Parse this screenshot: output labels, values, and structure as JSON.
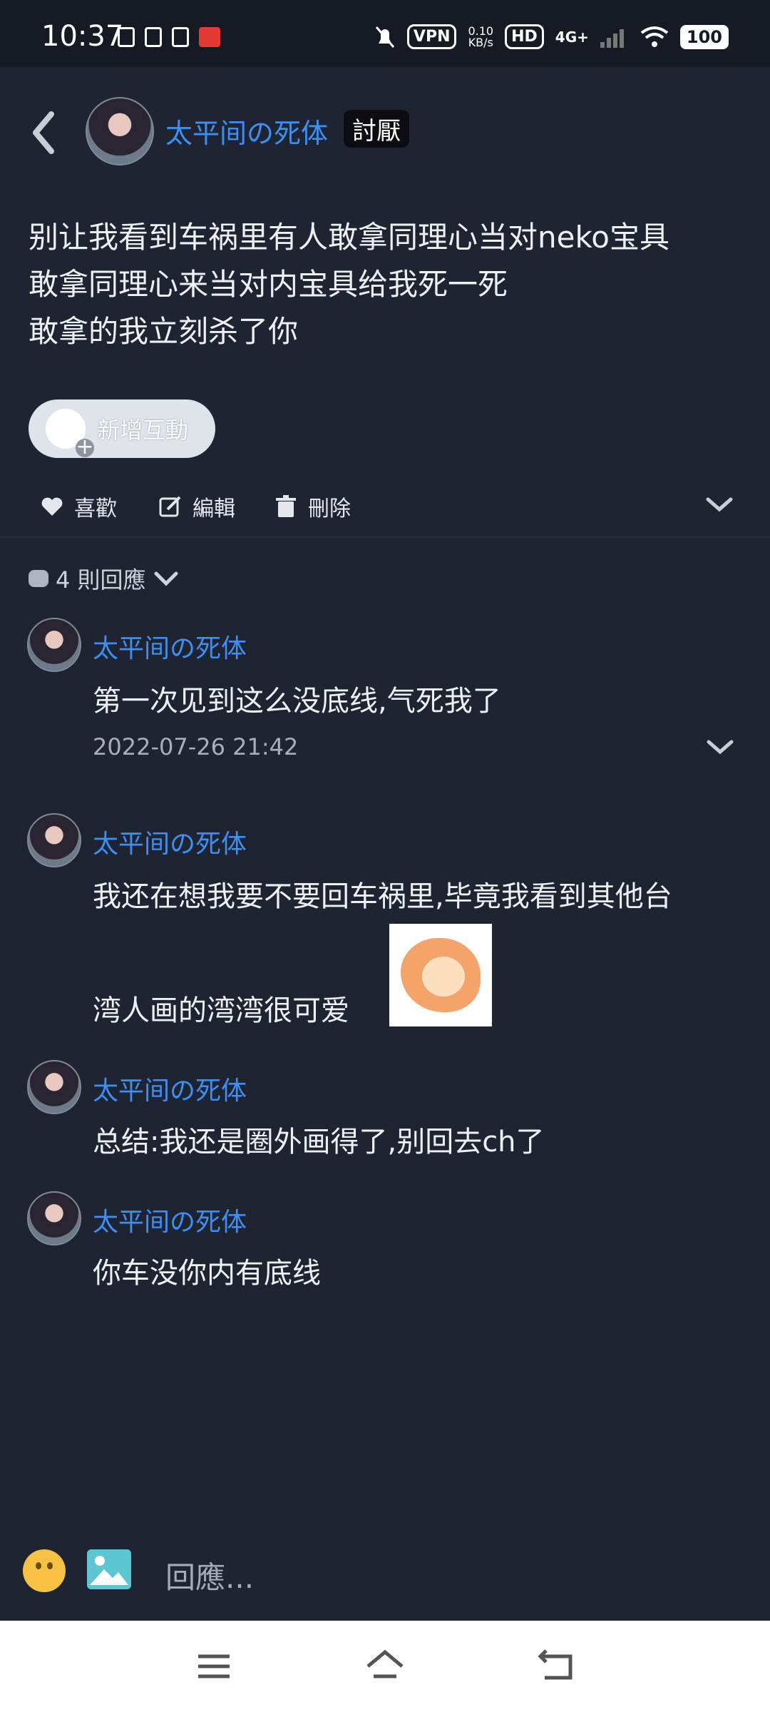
{
  "status_bar": {
    "time": "10:37",
    "vpn_label": "VPN",
    "net_speed": "0.10",
    "net_speed_unit": "KB/s",
    "hd_label": "HD",
    "signal_label": "4G+",
    "battery": "100"
  },
  "post": {
    "author_name": "太平间の死体",
    "tag": "討厭",
    "body_lines": [
      "别让我看到车祸里有人敢拿同理心当对neko宝具",
      "敢拿同理心来当对内宝具给我死一死",
      "敢拿的我立刻杀了你"
    ],
    "add_interaction_label": "新增互動",
    "actions": {
      "like": "喜歡",
      "edit": "編輯",
      "delete": "刪除"
    }
  },
  "replies": {
    "count_label": "4 則回應",
    "items": [
      {
        "name": "太平间の死体",
        "text": "第一次见到这么没底线,气死我了",
        "time": "2022-07-26 21:42"
      },
      {
        "name": "太平间の死体",
        "text_line1": "我还在想我要不要回车祸里,毕竟我看到其他台",
        "text_line2": "湾人画的湾湾很可爱"
      },
      {
        "name": "太平间の死体",
        "text": "总结:我还是圈外画得了,别回去ch了"
      },
      {
        "name": "太平间の死体",
        "text": "你车没你内有底线"
      }
    ]
  },
  "composer": {
    "placeholder": "回應..."
  },
  "colors": {
    "background": "#1f2432",
    "accent_name": "#3f8ef3"
  }
}
